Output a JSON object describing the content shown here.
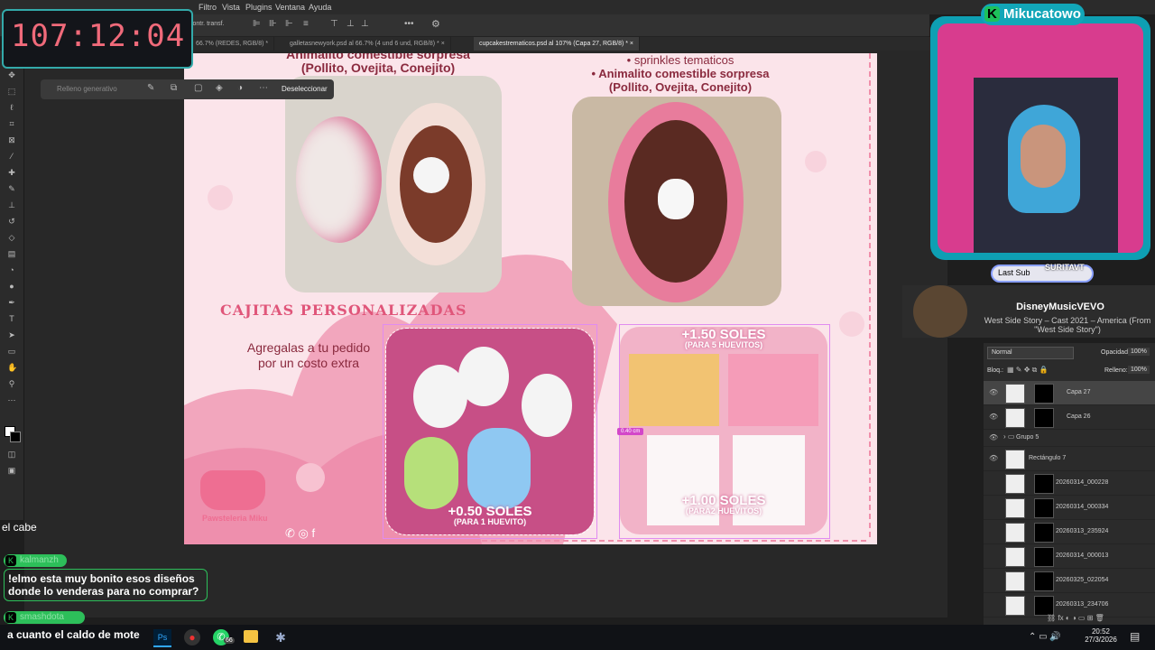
{
  "menu": {
    "items": [
      "Filtro",
      "Vista",
      "Plugins",
      "Ventana",
      "Ayuda"
    ],
    "brand_text": "Mikucatowo"
  },
  "tabs": [
    {
      "label": "66.7% (REDES, RGB/8) *"
    },
    {
      "label": "galletasnewyork.psd al 66.7% (4 und  6 und, RGB/8) *"
    },
    {
      "label": "cupcakestrematicos.psd al 107% (Capa 27, RGB/8) *",
      "active": true
    }
  ],
  "options_bar": {
    "label": "contr. transf."
  },
  "context_bar": {
    "generative_fill": "Relleno generativo",
    "deselect": "Deseleccionar"
  },
  "timer": {
    "text": "107:12:04"
  },
  "artboard": {
    "top_text": {
      "line1": "Animalito comestible sorpresa",
      "line2": "(Pollito, Ovejita, Conejito)",
      "line3": "sprinkles tematicos",
      "line4": "Animalito comestible sorpresa",
      "line5": "(Pollito, Ovejita, Conejito)"
    },
    "section_title": "Cajitas personalizadas",
    "extra_note_line1": "Agregalas a tu pedido",
    "extra_note_line2": "por un costo extra",
    "price1_main": "+0.50 soles",
    "price1_sub": "(Para 1 huevito)",
    "price2_main": "+1.50 soles",
    "price2_sub": "(Para 5 huevitos)",
    "price3_main": "+1.00 soles",
    "price3_sub": "(Para2 huevitos)",
    "logo_text": "Pawsteleria Miku",
    "measure_badge": "0.40 cm"
  },
  "webcam": {
    "last_sub_label": "Last Sub",
    "last_sub_name": "SURITAVT"
  },
  "now_playing": {
    "channel": "DisneyMusicVEVO",
    "title": "West Side Story – Cast 2021 – America (From \"West Side Story\")"
  },
  "layers_panel": {
    "blend_mode": "Normal",
    "opacity_label": "Opacidad:",
    "opacity_value": "100%",
    "lock_label": "Bloq.:",
    "fill_label": "Relleno:",
    "fill_value": "100%",
    "layers": [
      {
        "name": "Capa 27",
        "visible": true
      },
      {
        "name": "Capa 26",
        "visible": true
      },
      {
        "name": "Grupo 5",
        "visible": true,
        "group": true
      },
      {
        "name": "Rectángulo 7",
        "visible": true
      },
      {
        "name": "20260314_000228",
        "visible": false
      },
      {
        "name": "20260314_000334",
        "visible": false
      },
      {
        "name": "20260313_235924",
        "visible": false
      },
      {
        "name": "20260314_000013",
        "visible": false
      },
      {
        "name": "20260325_022054",
        "visible": false
      },
      {
        "name": "20260313_234706",
        "visible": false
      }
    ]
  },
  "chat": [
    {
      "user": "",
      "message": "el cabe"
    },
    {
      "user": "kalmanzh",
      "message": "!elmo esta muy bonito esos diseños donde lo venderas para no comprar?"
    },
    {
      "user": "smashdota",
      "message": "a cuanto el caldo de mote"
    }
  ],
  "taskbar": {
    "time": "20:52",
    "date": "27/3/2026",
    "badge": "66"
  },
  "colors": {
    "accent": "#e0567a",
    "timer": "#f06a7a",
    "cam_border": "#12a6b8",
    "artboard_bg": "#fbe4ea"
  }
}
